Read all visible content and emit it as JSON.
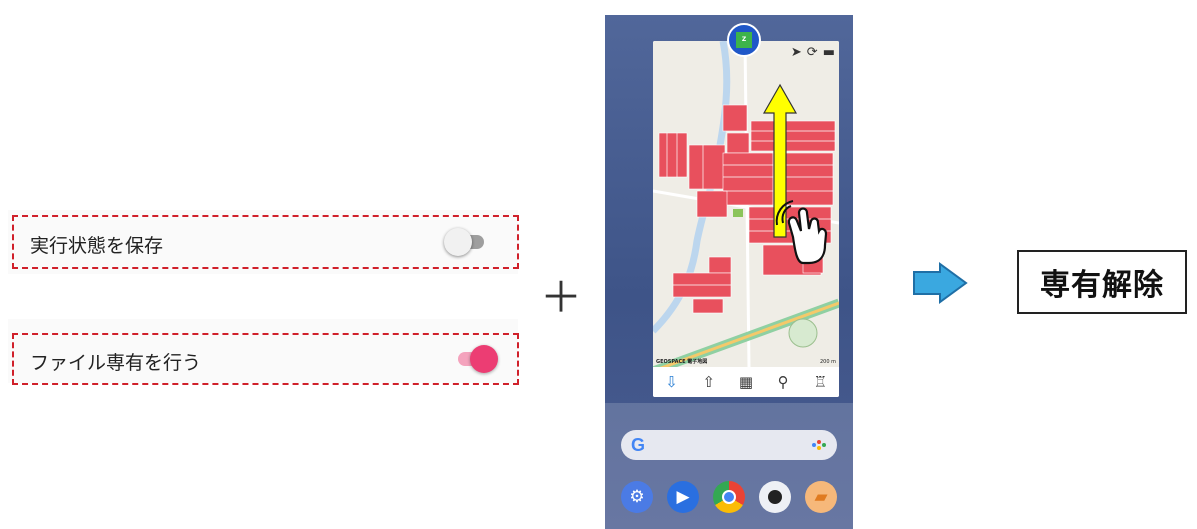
{
  "settings": [
    {
      "label": "実行状態を保存",
      "enabled": false
    },
    {
      "label": "ファイル専有を行う",
      "enabled": true
    }
  ],
  "plus_symbol": "＋",
  "phone": {
    "map_attribution": "GEOSPACE 電子地図",
    "map_scale": "200 m",
    "app_icon_text": "Z",
    "map_top_icons": [
      "navigation-arrow-icon",
      "sync-icon",
      "car-icon"
    ],
    "toolbar_icons": [
      "download-icon",
      "upload-icon",
      "table-icon",
      "search-icon",
      "paint-roller-icon"
    ],
    "search_logo": "G",
    "dock_apps": [
      "settings-icon",
      "meet-icon",
      "chrome-icon",
      "camera-icon",
      "files-icon"
    ],
    "gesture": "swipe-up"
  },
  "release_label": "専有解除",
  "colors": {
    "highlight_dashed": "#d0202a",
    "toggle_on": "#ec3d73",
    "swipe_arrow": "#ffff00",
    "parcel_red": "#e8505d",
    "arrow_blue": "#3aa8e0"
  }
}
